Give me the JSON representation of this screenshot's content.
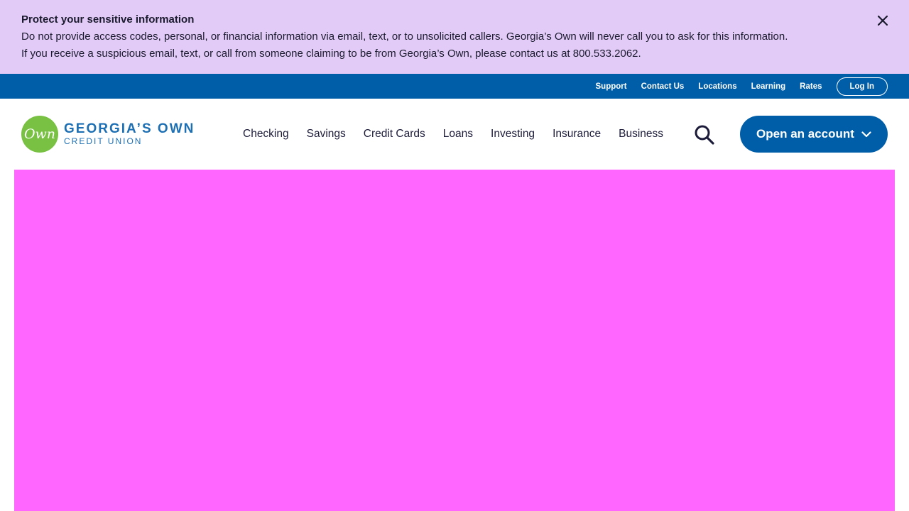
{
  "alert": {
    "title": "Protect your sensitive information",
    "body": "Do not provide access codes, personal, or financial information via email, text, or to unsolicited callers. Georgia’s Own will never call you to ask for this information. If you receive a suspicious email, text, or call from someone claiming to be from Georgia’s Own, please contact us at 800.533.2062.",
    "close_icon": "close-icon",
    "background": "#e3cbf7"
  },
  "utility_nav": {
    "links": [
      "Support",
      "Contact Us",
      "Locations",
      "Learning",
      "Rates"
    ],
    "login_label": "Log In",
    "background": "#005ea8"
  },
  "logo": {
    "mark": "Own",
    "line1": "GEORGIA’S OWN",
    "line2": "CREDIT UNION",
    "mark_color": "#78c142",
    "text_color": "#1d6fb3"
  },
  "main_nav": {
    "items": [
      "Checking",
      "Savings",
      "Credit Cards",
      "Loans",
      "Investing",
      "Insurance",
      "Business"
    ],
    "search_icon": "search-icon"
  },
  "cta": {
    "label": "Open an account",
    "icon": "chevron-down-icon",
    "background": "#005ea8"
  },
  "hero": {
    "background": "#ff66ff"
  }
}
